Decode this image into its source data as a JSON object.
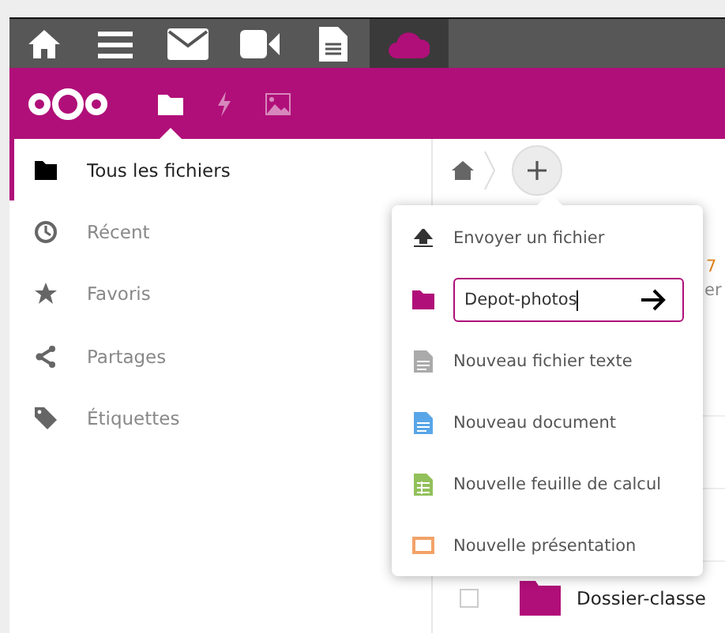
{
  "launcher": [
    {
      "kind": "home",
      "selected": false
    },
    {
      "kind": "menu",
      "selected": false
    },
    {
      "kind": "mail",
      "selected": false
    },
    {
      "kind": "video",
      "selected": false
    },
    {
      "kind": "document",
      "selected": false
    },
    {
      "kind": "cloud",
      "selected": true
    }
  ],
  "app_bar": [
    {
      "kind": "files",
      "selected": true
    },
    {
      "kind": "activity",
      "selected": false
    },
    {
      "kind": "gallery",
      "selected": false
    }
  ],
  "sidebar": {
    "items": [
      {
        "kind": "folder",
        "label": "Tous les fichiers",
        "selected": true
      },
      {
        "kind": "clock",
        "label": "Récent",
        "selected": false
      },
      {
        "kind": "star",
        "label": "Favoris",
        "selected": false
      },
      {
        "kind": "share",
        "label": "Partages",
        "selected": false
      },
      {
        "kind": "tag",
        "label": "Étiquettes",
        "selected": false
      }
    ]
  },
  "background_fragments": [
    "7",
    "er"
  ],
  "new_menu": {
    "items": [
      {
        "kind": "upload",
        "label": "Envoyer un fichier"
      },
      {
        "kind": "folder-input",
        "value": "Depot-photos"
      },
      {
        "kind": "text",
        "label": "Nouveau fichier texte"
      },
      {
        "kind": "document",
        "label": "Nouveau document"
      },
      {
        "kind": "spreadsheet",
        "label": "Nouvelle feuille de calcul"
      },
      {
        "kind": "presentation",
        "label": "Nouvelle présentation"
      }
    ]
  },
  "files": [
    {
      "name": "Dossier-classe",
      "checked": false
    }
  ]
}
